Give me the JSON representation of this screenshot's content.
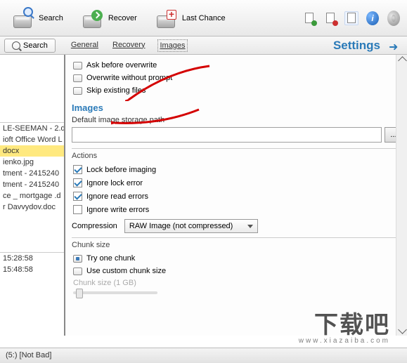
{
  "toolbar": {
    "search": "Search",
    "recover": "Recover",
    "last_chance": "Last Chance"
  },
  "subbar": {
    "search_tab": "Search",
    "tabs": {
      "general": "General",
      "recovery": "Recovery",
      "images": "Images"
    },
    "settings_title": "Settings"
  },
  "left": {
    "files": [
      "LE-SEEMAN - 2.d",
      "ioft Office Word L",
      "docx",
      "ienko.jpg",
      "tment - 2415240",
      "tment - 2415240",
      "ce _ mortgage .d",
      "r Davvydov.doc"
    ],
    "times": [
      "15:28:58",
      "15:48:58"
    ]
  },
  "panel": {
    "overwrite": {
      "ask": "Ask before overwrite",
      "without": "Overwrite without prompt",
      "skip": "Skip existing files"
    },
    "images_title": "Images",
    "default_path_label": "Default image storage path",
    "actions": {
      "title": "Actions",
      "lock_before": "Lock before imaging",
      "ignore_lock": "Ignore lock error",
      "ignore_read": "Ignore read errors",
      "ignore_write": "Ignore write errors"
    },
    "compression": {
      "label": "Compression",
      "value": "RAW Image (not compressed)"
    },
    "chunk": {
      "title": "Chunk size",
      "try_one": "Try one chunk",
      "custom": "Use custom chunk size",
      "size_label": "Chunk size (1 GB)"
    }
  },
  "status": "(5:) [Not Bad]",
  "watermark": {
    "line1": "下载吧",
    "line2": "www.xiazaiba.com"
  }
}
